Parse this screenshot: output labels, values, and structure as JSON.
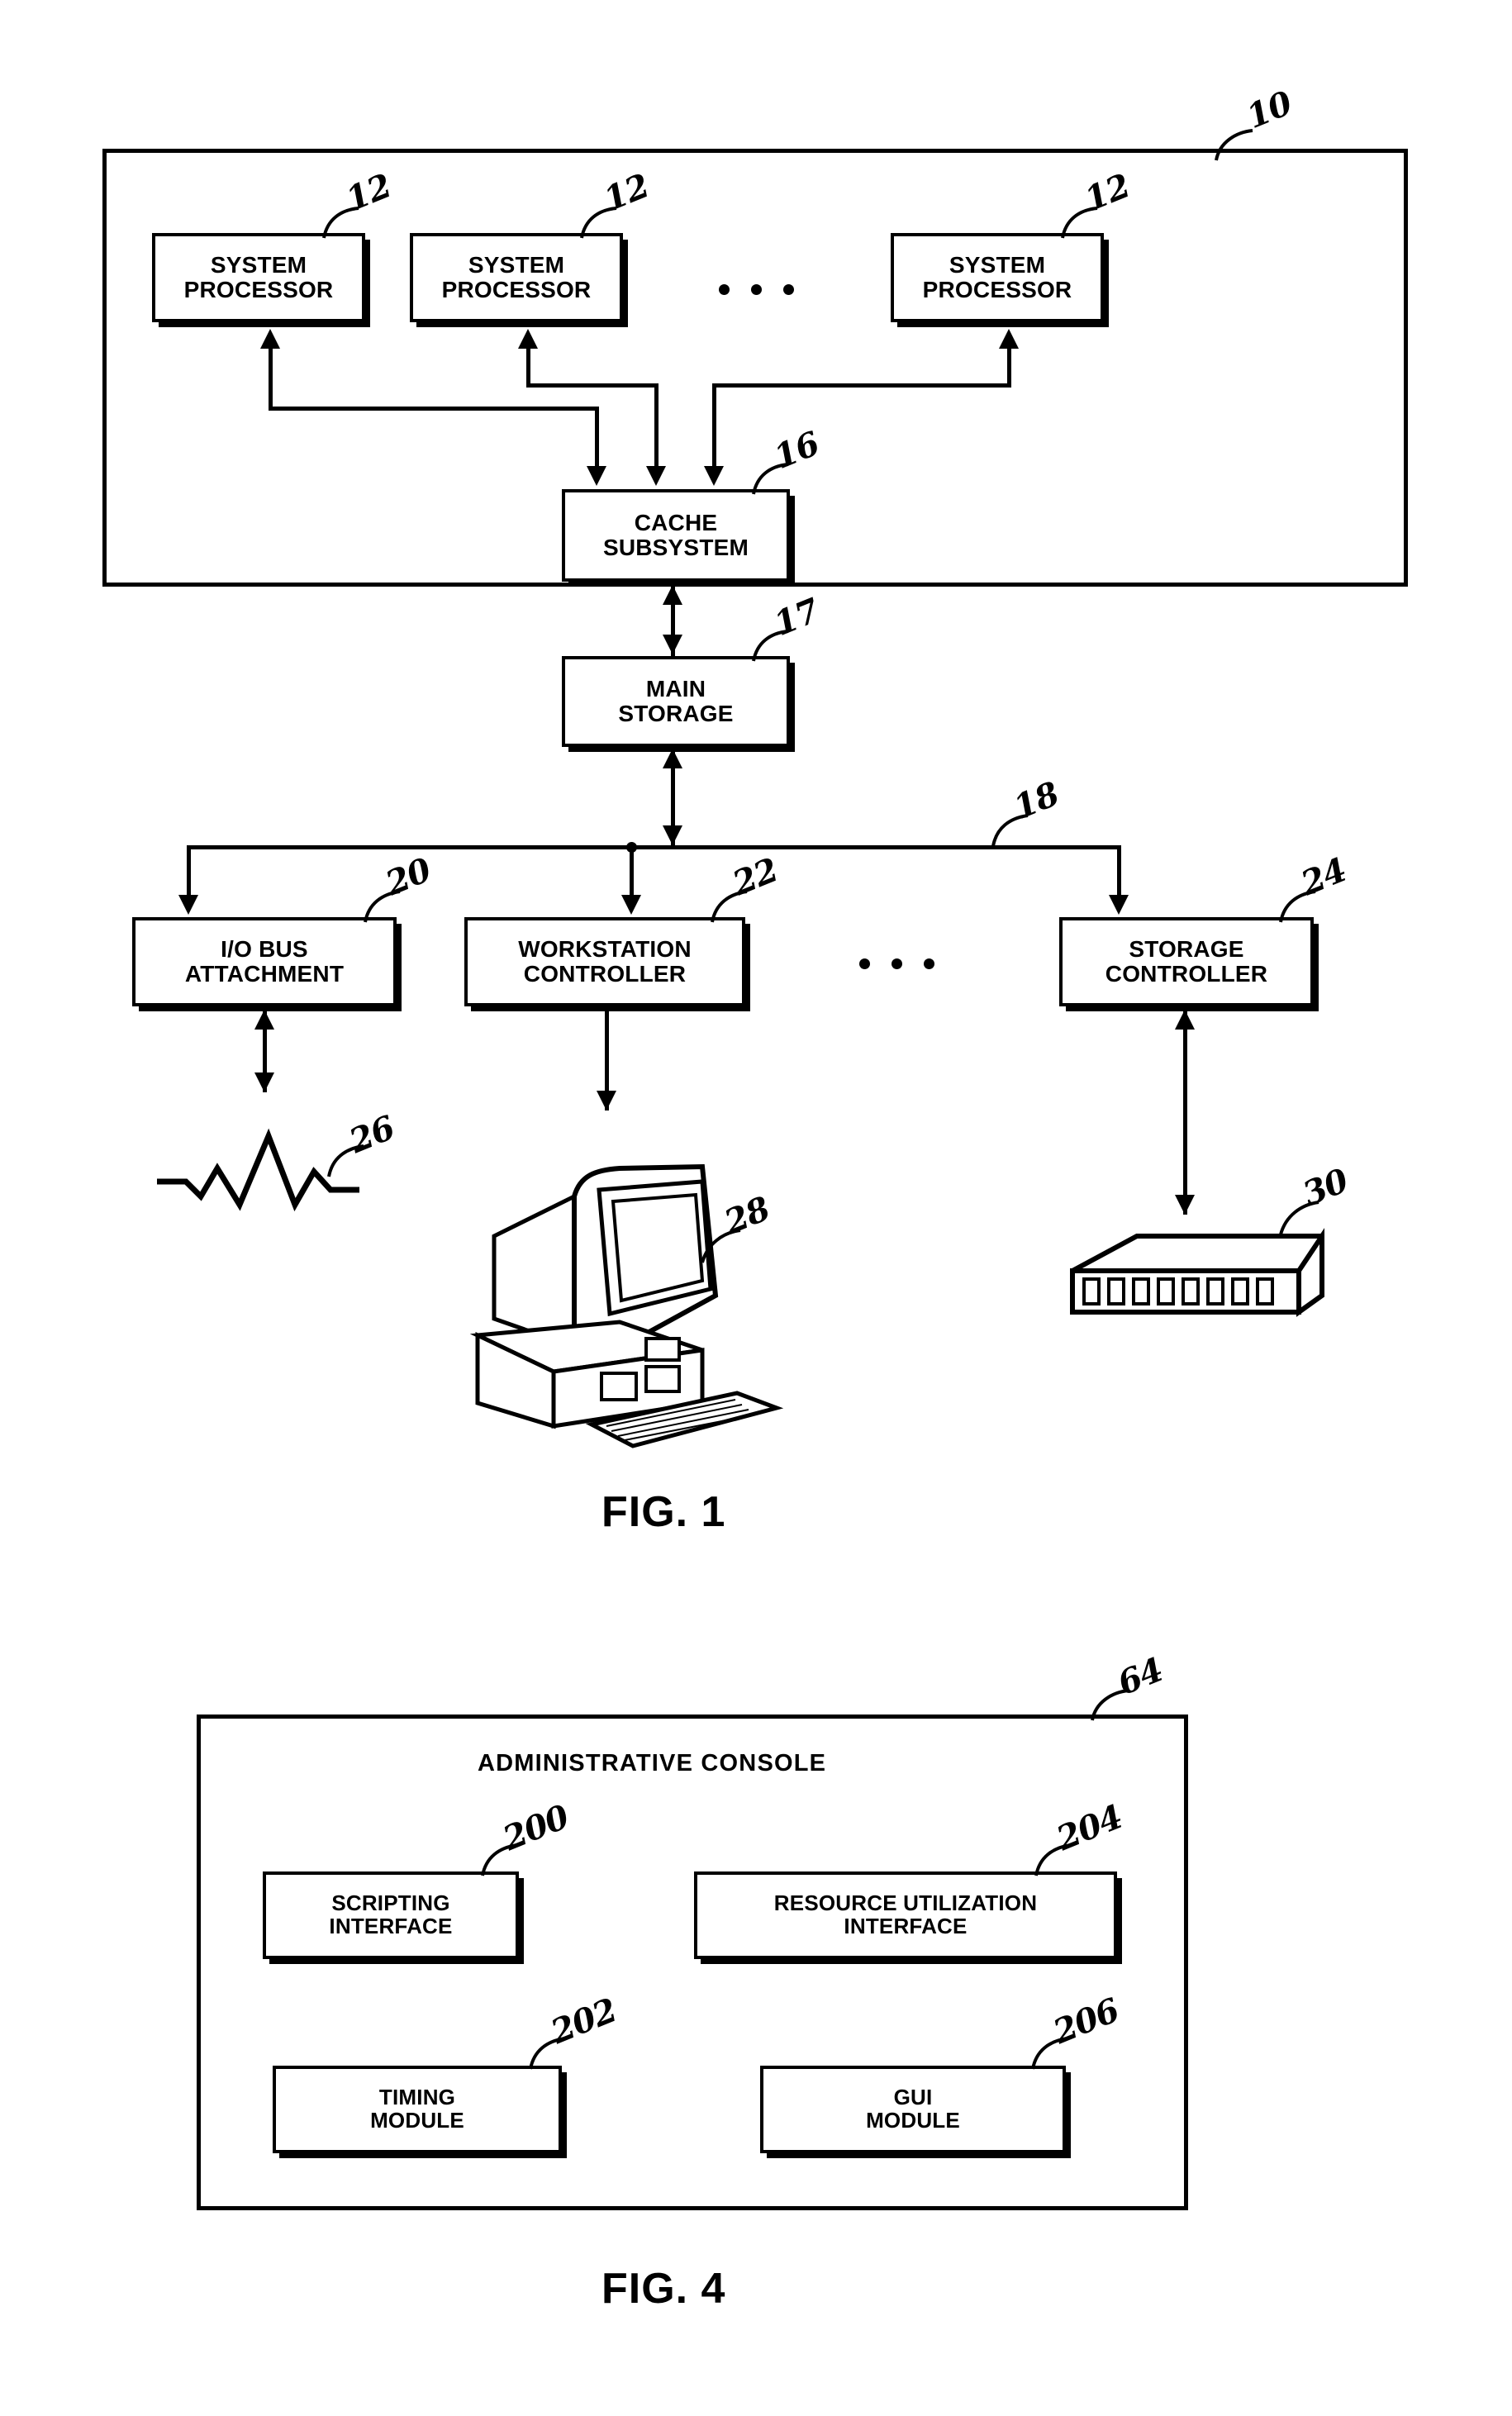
{
  "figure1": {
    "caption": "FIG. 1",
    "system_ref": "10",
    "processors": [
      {
        "label_line1": "SYSTEM",
        "label_line2": "PROCESSOR",
        "ref": "12"
      },
      {
        "label_line1": "SYSTEM",
        "label_line2": "PROCESSOR",
        "ref": "12"
      },
      {
        "label_line1": "SYSTEM",
        "label_line2": "PROCESSOR",
        "ref": "12"
      }
    ],
    "processor_ellipsis": "...",
    "cache": {
      "label_line1": "CACHE",
      "label_line2": "SUBSYSTEM",
      "ref": "16"
    },
    "main_storage": {
      "label_line1": "MAIN",
      "label_line2": "STORAGE",
      "ref": "17"
    },
    "bus_ref": "18",
    "controllers": [
      {
        "label_line1": "I/O BUS",
        "label_line2": "ATTACHMENT",
        "ref": "20"
      },
      {
        "label_line1": "WORKSTATION",
        "label_line2": "CONTROLLER",
        "ref": "22"
      },
      {
        "label_line1": "STORAGE",
        "label_line2": "CONTROLLER",
        "ref": "24"
      }
    ],
    "controller_ellipsis": "...",
    "peripherals": [
      {
        "name": "network-link",
        "ref": "26"
      },
      {
        "name": "workstation-computer",
        "ref": "28"
      },
      {
        "name": "storage-device",
        "ref": "30"
      }
    ]
  },
  "figure4": {
    "caption": "FIG. 4",
    "console_ref": "64",
    "title": "ADMINISTRATIVE CONSOLE",
    "modules": [
      {
        "label_line1": "SCRIPTING",
        "label_line2": "INTERFACE",
        "ref": "200"
      },
      {
        "label_line1": "RESOURCE UTILIZATION",
        "label_line2": "INTERFACE",
        "ref": "204"
      },
      {
        "label_line1": "TIMING",
        "label_line2": "MODULE",
        "ref": "202"
      },
      {
        "label_line1": "GUI",
        "label_line2": "MODULE",
        "ref": "206"
      }
    ]
  },
  "colors": {
    "ink": "#000000",
    "paper": "#ffffff"
  }
}
